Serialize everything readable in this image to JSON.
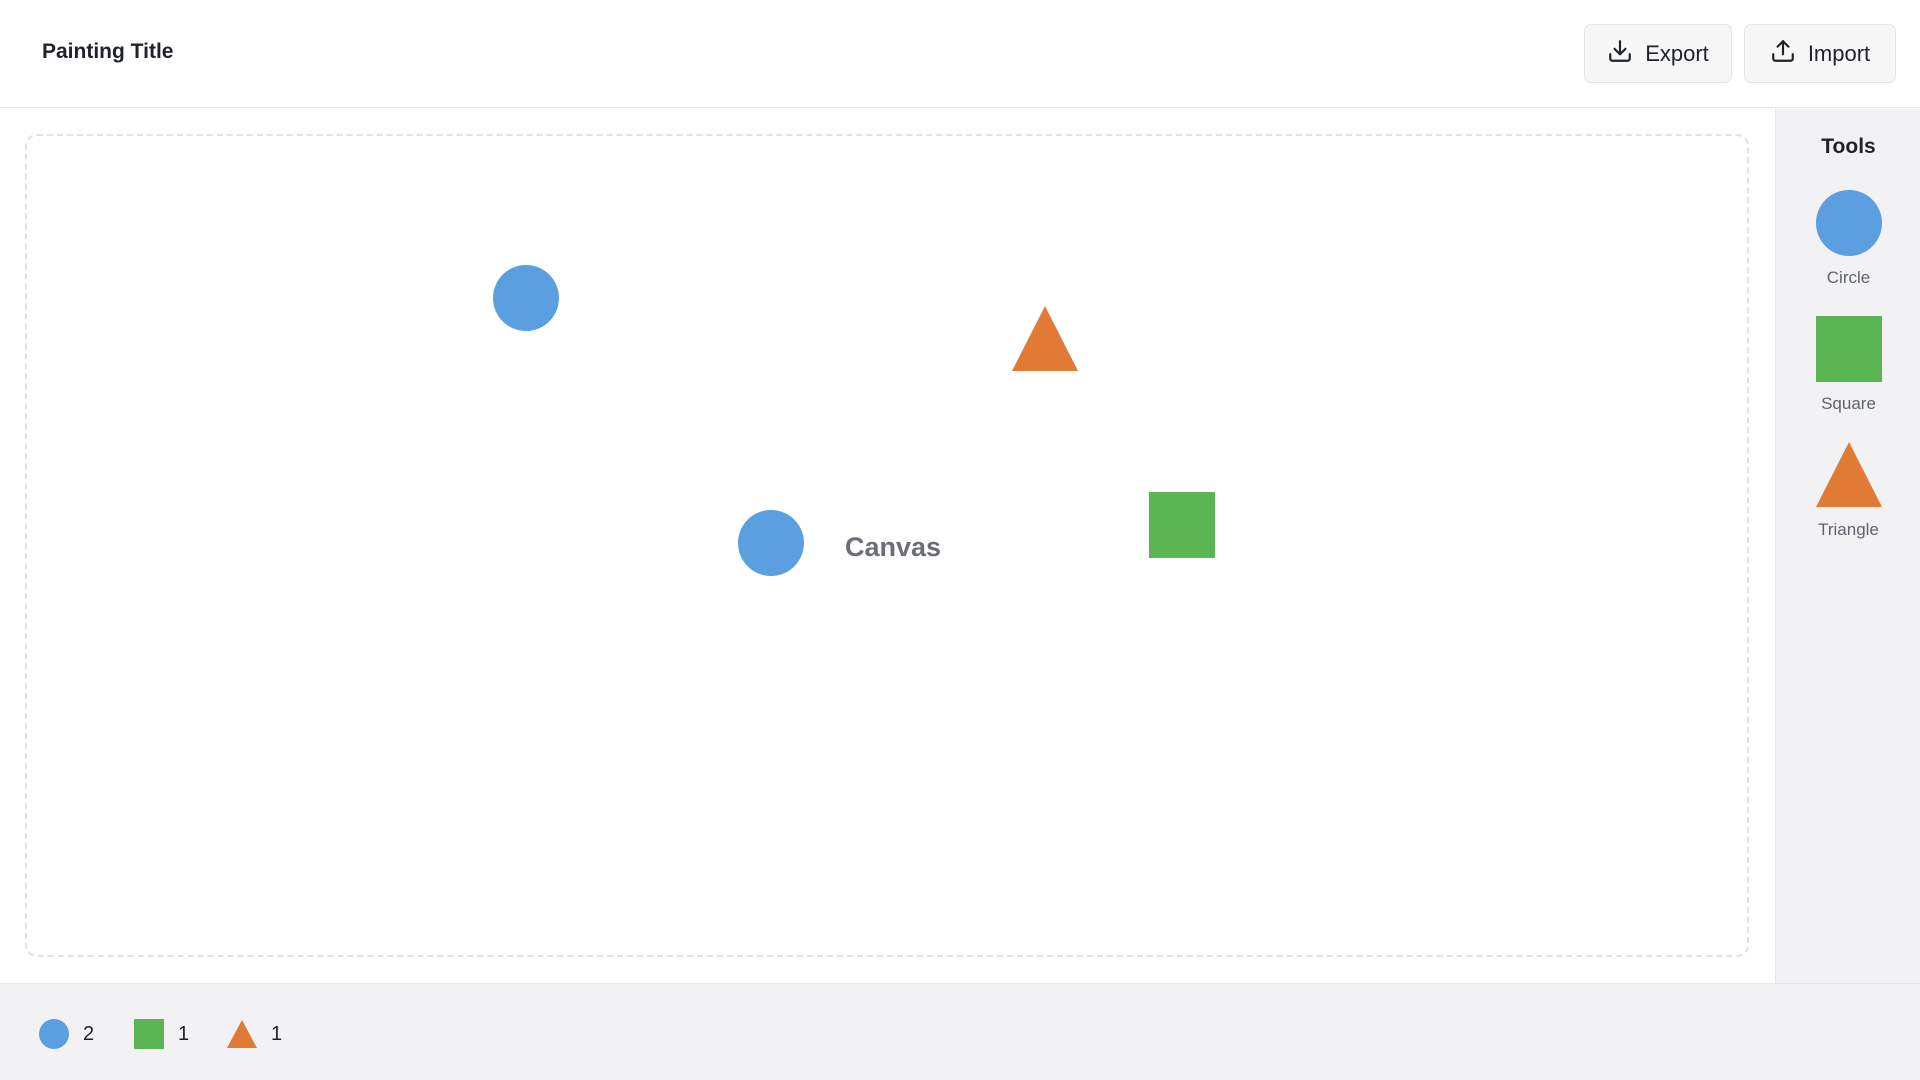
{
  "header": {
    "title": "Painting Title",
    "export_label": "Export",
    "import_label": "Import"
  },
  "canvas": {
    "label": "Canvas",
    "shapes": [
      {
        "type": "circle",
        "color": "#5b9fe1"
      },
      {
        "type": "triangle",
        "color": "#e07a35"
      },
      {
        "type": "circle",
        "color": "#5b9fe1"
      },
      {
        "type": "square",
        "color": "#5cb553"
      }
    ]
  },
  "tools": {
    "title": "Tools",
    "items": [
      {
        "label": "Circle",
        "icon": "circle-icon",
        "color": "#5b9fe1"
      },
      {
        "label": "Square",
        "icon": "square-icon",
        "color": "#5cb553"
      },
      {
        "label": "Triangle",
        "icon": "triangle-icon",
        "color": "#e07a35"
      }
    ]
  },
  "counts": {
    "circle": "2",
    "square": "1",
    "triangle": "1"
  },
  "colors": {
    "circle": "#5b9fe1",
    "square": "#5cb553",
    "triangle": "#e07a35"
  }
}
